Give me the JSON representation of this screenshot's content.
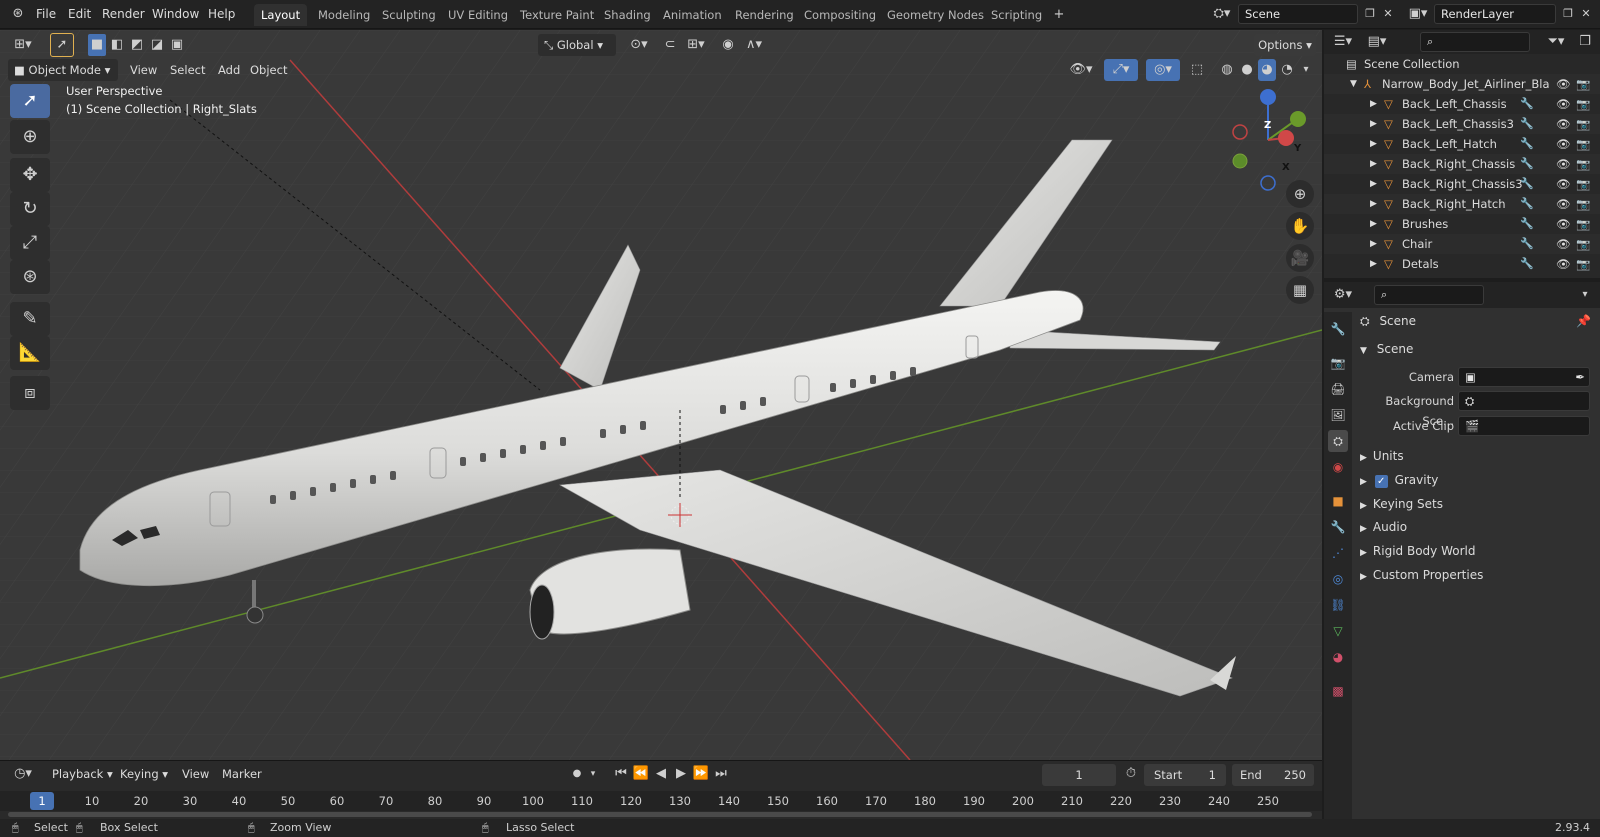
{
  "topbar": {
    "menus": [
      "File",
      "Edit",
      "Render",
      "Window",
      "Help"
    ],
    "workspaces": [
      "Layout",
      "Modeling",
      "Sculpting",
      "UV Editing",
      "Texture Paint",
      "Shading",
      "Animation",
      "Rendering",
      "Compositing",
      "Geometry Nodes",
      "Scripting"
    ],
    "active_workspace": "Layout",
    "scene_name": "Scene",
    "render_layer": "RenderLayer"
  },
  "viewport": {
    "orientation": "Global",
    "options_label": "Options",
    "mode": "Object Mode",
    "menus": [
      "View",
      "Select",
      "Add",
      "Object"
    ],
    "overlay_title": "User Perspective",
    "overlay_subtitle": "(1) Scene Collection | Right_Slats",
    "gizmo": {
      "z": "Z",
      "y": "Y",
      "x": "X"
    }
  },
  "outliner": {
    "root": "Scene Collection",
    "parent": "Narrow_Body_Jet_Airliner_Bla",
    "items": [
      "Back_Left_Chassis",
      "Back_Left_Chassis3",
      "Back_Left_Hatch",
      "Back_Right_Chassis",
      "Back_Right_Chassis3",
      "Back_Right_Hatch",
      "Brushes",
      "Chair",
      "Detals"
    ]
  },
  "properties": {
    "context": "Scene",
    "section": "Scene",
    "fields": [
      {
        "label": "Camera"
      },
      {
        "label": "Background Sce..."
      },
      {
        "label": "Active Clip"
      }
    ],
    "panels": [
      "Units",
      "Gravity",
      "Keying Sets",
      "Audio",
      "Rigid Body World",
      "Custom Properties"
    ]
  },
  "timeline": {
    "menus": [
      "Playback",
      "Keying",
      "View",
      "Marker"
    ],
    "current_frame": "1",
    "start_label": "Start",
    "start_value": "1",
    "end_label": "End",
    "end_value": "250",
    "ticks": [
      "1",
      "10",
      "20",
      "30",
      "40",
      "50",
      "60",
      "70",
      "80",
      "90",
      "100",
      "110",
      "120",
      "130",
      "140",
      "150",
      "160",
      "170",
      "180",
      "190",
      "200",
      "210",
      "220",
      "230",
      "240",
      "250"
    ]
  },
  "statusbar": {
    "select": "Select",
    "box_select": "Box Select",
    "zoom_view": "Zoom View",
    "lasso_select": "Lasso Select",
    "version": "2.93.4"
  },
  "colors": {
    "accent": "#4772b3",
    "bg": "#393939",
    "header": "#232323",
    "x_axis": "#c04343",
    "y_axis": "#6a9a2a"
  }
}
